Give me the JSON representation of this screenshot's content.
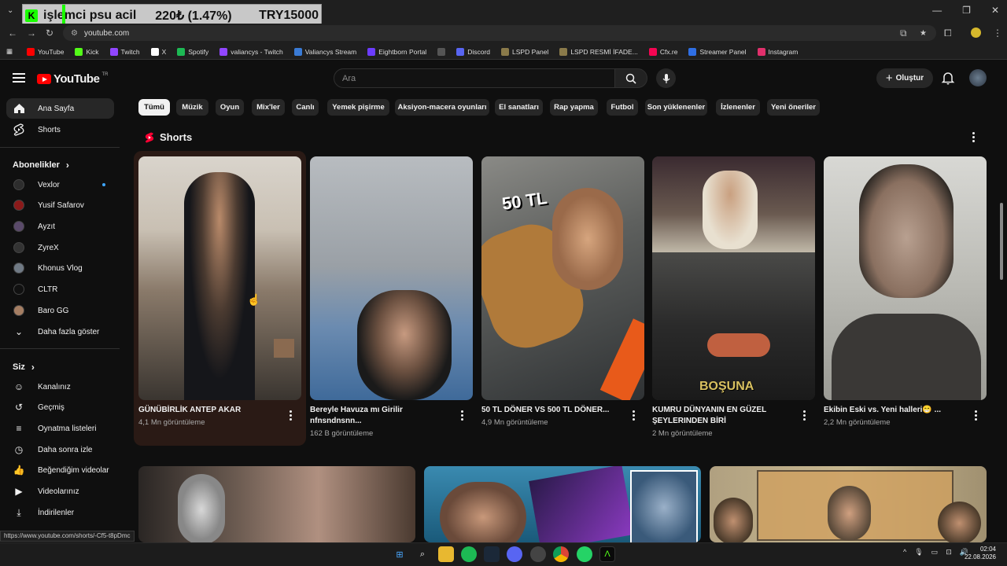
{
  "overlay": {
    "k_label": "K",
    "title": "işlemci psu acil",
    "amount": "220₺ (1.47%)",
    "goal": "TRY15000"
  },
  "browser": {
    "url": "youtube.com",
    "bookmarks": [
      {
        "label": "YouTube",
        "color": "#ff0000"
      },
      {
        "label": "Kick",
        "color": "#53fc18"
      },
      {
        "label": "Twitch",
        "color": "#9146ff"
      },
      {
        "label": "X",
        "color": "#ffffff"
      },
      {
        "label": "Spotify",
        "color": "#1db954"
      },
      {
        "label": "valiancys - Twitch",
        "color": "#9146ff"
      },
      {
        "label": "Valiancys Stream",
        "color": "#3a7bd5"
      },
      {
        "label": "Eightborn Portal",
        "color": "#6c3cff"
      },
      {
        "label": "",
        "color": "#555555"
      },
      {
        "label": "Discord",
        "color": "#5865f2"
      },
      {
        "label": "LSPD Panel",
        "color": "#8a7a4a"
      },
      {
        "label": "LSPD  RESMİ İFADE...",
        "color": "#8a7a4a"
      },
      {
        "label": "Cfx.re",
        "color": "#f40552"
      },
      {
        "label": "Streamer Panel",
        "color": "#2f6fe4"
      },
      {
        "label": "Instagram",
        "color": "#e1306c"
      }
    ]
  },
  "header": {
    "logo_text": "YouTube",
    "logo_sup": "TR",
    "search_placeholder": "Ara",
    "create_label": "Oluştur"
  },
  "sidebar": {
    "main": [
      {
        "label": "Ana Sayfa",
        "icon": "home-icon"
      },
      {
        "label": "Shorts",
        "icon": "shorts-icon"
      }
    ],
    "subs_title": "Abonelikler",
    "subs": [
      {
        "label": "Vexlor",
        "color": "#2d2d2d",
        "dot": true
      },
      {
        "label": "Yusif Safarov",
        "color": "#8b1a1a"
      },
      {
        "label": "Ayzıt",
        "color": "#5a4a6a"
      },
      {
        "label": "ZyreX",
        "color": "#333333"
      },
      {
        "label": "Khonus Vlog",
        "color": "#707a85"
      },
      {
        "label": "CLTR",
        "color": "#111111"
      },
      {
        "label": "Baro GG",
        "color": "#a57e63"
      }
    ],
    "more_label": "Daha fazla göster",
    "you_title": "Siz",
    "you": [
      {
        "label": "Kanalınız",
        "icon": "channel-icon"
      },
      {
        "label": "Geçmiş",
        "icon": "history-icon"
      },
      {
        "label": "Oynatma listeleri",
        "icon": "playlist-icon"
      },
      {
        "label": "Daha sonra izle",
        "icon": "clock-icon"
      },
      {
        "label": "Beğendiğim videolar",
        "icon": "like-icon"
      },
      {
        "label": "Videolarınız",
        "icon": "video-icon"
      },
      {
        "label": "İndirilenler",
        "icon": "download-icon"
      }
    ]
  },
  "chips": [
    "Tümü",
    "Müzik",
    "Oyun",
    "Mix'ler",
    "Canlı",
    "Yemek pişirme",
    "Aksiyon-macera oyunları",
    "El sanatları",
    "Rap yapma",
    "Futbol",
    "Son yüklenenler",
    "İzlenenler",
    "Yeni öneriler"
  ],
  "shorts": {
    "title": "Shorts",
    "items": [
      {
        "line1": "GÜNÜBİRLİK ANTEP AKAR",
        "line2": "",
        "views": "4,1 Mn görüntüleme"
      },
      {
        "line1": "Bereyle Havuza mı Girilir",
        "line2": "nfnsndnsnn...",
        "views": "162 B görüntüleme"
      },
      {
        "line1": "50 TL DÖNER VS 500 TL DÖNER...",
        "line2": "",
        "views": "4,9 Mn görüntüleme",
        "overlay_text": "50 TL"
      },
      {
        "line1": "KUMRU DÜNYANIN EN GÜZEL",
        "line2": "ŞEYLERINDEN BİRİ",
        "views": "2 Mn görüntüleme",
        "overlay_text": "BOŞUNA"
      },
      {
        "line1": "Ekibin Eski vs. Yeni halleri😁 ...",
        "line2": "",
        "views": "2,2 Mn görüntüleme"
      }
    ]
  },
  "status_url": "https://www.youtube.com/shorts/-Cf5-t8pDmc",
  "clock": {
    "time": "02:04",
    "date": "22.08.2026"
  }
}
